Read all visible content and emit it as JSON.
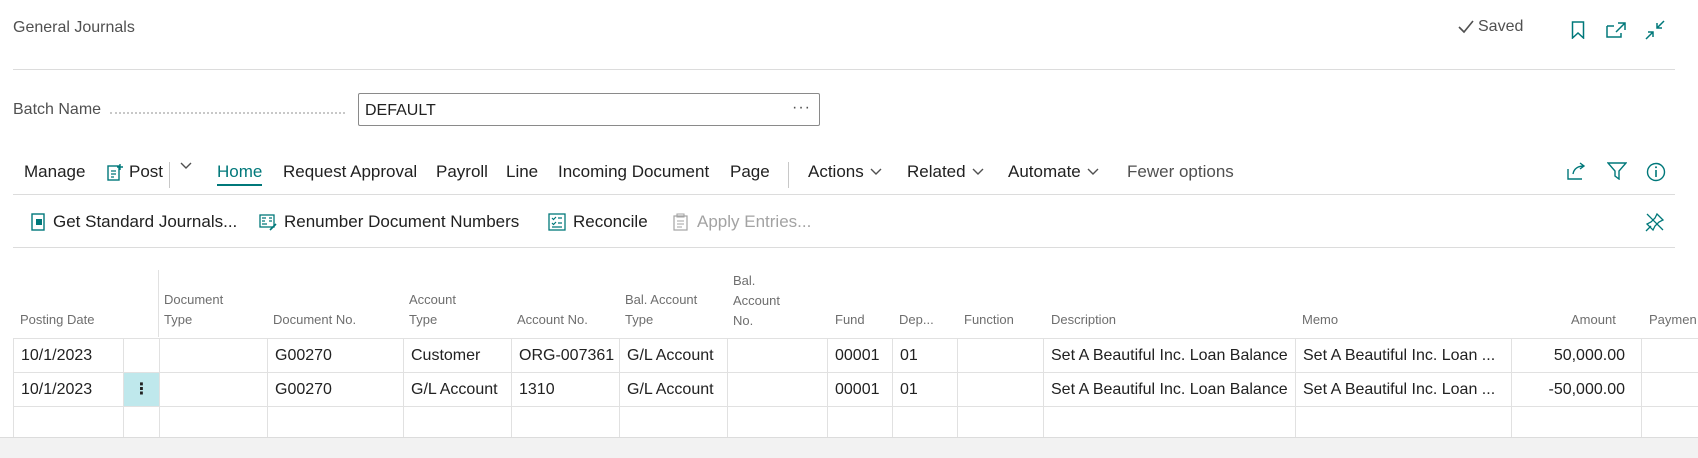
{
  "header": {
    "title": "General Journals",
    "saved_label": "Saved",
    "icons": [
      "checkmark-icon",
      "bookmark-icon",
      "open-in-new-window-icon",
      "collapse-icon"
    ]
  },
  "batch": {
    "label": "Batch Name",
    "value": "DEFAULT",
    "more": "···"
  },
  "menu": {
    "items": [
      {
        "id": "manage",
        "label": "Manage"
      },
      {
        "id": "post",
        "label": "Post"
      },
      {
        "id": "home",
        "label": "Home"
      },
      {
        "id": "request-approval",
        "label": "Request Approval"
      },
      {
        "id": "payroll",
        "label": "Payroll"
      },
      {
        "id": "line",
        "label": "Line"
      },
      {
        "id": "incoming-document",
        "label": "Incoming Document"
      },
      {
        "id": "page",
        "label": "Page"
      },
      {
        "id": "actions",
        "label": "Actions"
      },
      {
        "id": "related",
        "label": "Related"
      },
      {
        "id": "automate",
        "label": "Automate"
      },
      {
        "id": "fewer-options",
        "label": "Fewer options"
      }
    ]
  },
  "toolbar": {
    "items": [
      {
        "label": "Get Standard Journals..."
      },
      {
        "label": "Renumber Document Numbers"
      },
      {
        "label": "Reconcile"
      },
      {
        "label": "Apply Entries..."
      }
    ]
  },
  "grid": {
    "columns": [
      {
        "key": "posting_date",
        "lines": [
          "Posting Date"
        ]
      },
      {
        "key": "document_type",
        "lines": [
          "Document",
          "Type"
        ]
      },
      {
        "key": "document_no",
        "lines": [
          "Document No."
        ]
      },
      {
        "key": "account_type",
        "lines": [
          "Account",
          "Type"
        ]
      },
      {
        "key": "account_no",
        "lines": [
          "Account No."
        ]
      },
      {
        "key": "bal_account_type",
        "lines": [
          "Bal. Account",
          "Type"
        ]
      },
      {
        "key": "bal_account_no",
        "lines": [
          "Bal.",
          "Account",
          "No."
        ]
      },
      {
        "key": "fund",
        "lines": [
          "Fund"
        ]
      },
      {
        "key": "dep",
        "lines": [
          "Dep..."
        ]
      },
      {
        "key": "function",
        "lines": [
          "Function"
        ]
      },
      {
        "key": "description",
        "lines": [
          "Description"
        ]
      },
      {
        "key": "memo",
        "lines": [
          "Memo"
        ]
      },
      {
        "key": "amount",
        "lines": [
          "Amount"
        ]
      },
      {
        "key": "payment",
        "lines": [
          "Paymen"
        ]
      }
    ],
    "rows": [
      {
        "posting_date": "10/1/2023",
        "document_type": "",
        "document_no": "G00270",
        "account_type": "Customer",
        "account_no": "ORG-007361",
        "bal_account_type": "G/L Account",
        "bal_account_no": "",
        "fund": "00001",
        "dep": "01",
        "function": "",
        "description": "Set A Beautiful Inc. Loan Balance",
        "memo": "Set A Beautiful Inc. Loan ...",
        "amount": "50,000.00",
        "payment": ""
      },
      {
        "posting_date": "10/1/2023",
        "document_type": "",
        "document_no": "G00270",
        "account_type": "G/L Account",
        "account_no": "1310",
        "bal_account_type": "G/L Account",
        "bal_account_no": "",
        "fund": "00001",
        "dep": "01",
        "function": "",
        "description": "Set A Beautiful Inc. Loan Balance",
        "memo": "Set A Beautiful Inc. Loan ...",
        "amount": "-50,000.00",
        "payment": ""
      }
    ],
    "row_menu_glyph": "⋮"
  },
  "colors": {
    "accent": "#00787a",
    "row_selected": "#bfe8ec"
  }
}
